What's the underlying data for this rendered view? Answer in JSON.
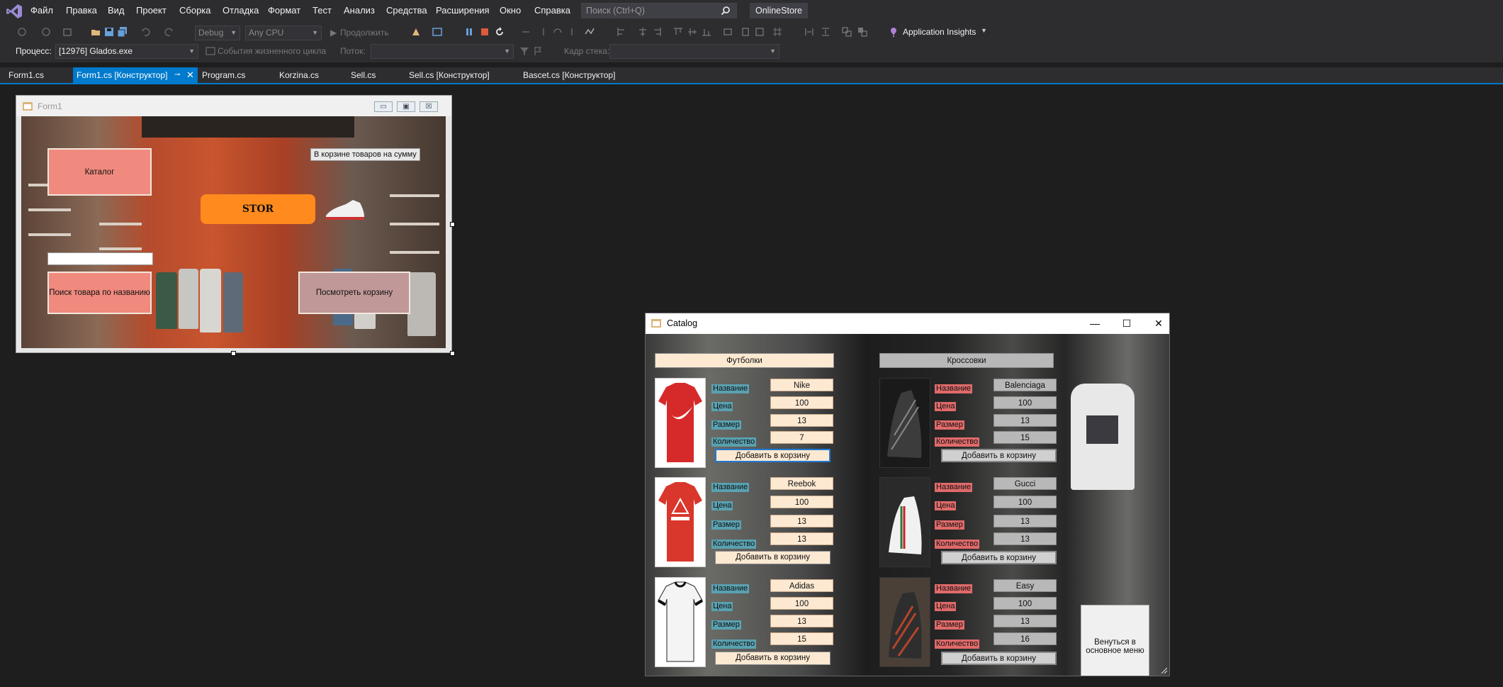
{
  "menubar": {
    "items": [
      "Файл",
      "Правка",
      "Вид",
      "Проект",
      "Сборка",
      "Отладка",
      "Формат",
      "Тест",
      "Анализ",
      "Средства",
      "Расширения",
      "Окно",
      "Справка"
    ],
    "search_placeholder": "Поиск (Ctrl+Q)",
    "solution_name": "OnlineStore"
  },
  "toolbar": {
    "config": "Debug",
    "platform": "Any CPU",
    "continue_label": "Продолжить",
    "app_insights": "Application Insights",
    "process_label": "Процесс:",
    "process_value": "[12976] Glados.exe",
    "lifecycle_label": "События жизненного цикла",
    "thread_label": "Поток:",
    "stack_label": "Кадр стека:"
  },
  "tabs": [
    "Form1.cs",
    "Form1.cs [Конструктор]",
    "Program.cs",
    "Korzina.cs",
    "Sell.cs",
    "Sell.cs [Конструктор]",
    "Bascet.cs [Конструктор]"
  ],
  "form1": {
    "title": "Form1",
    "catalog_button": "Каталог",
    "cart_sum_label": "В корзине товаров на сумму",
    "stor_logo": "STOR",
    "search_button": "Поиск товара по названию",
    "view_cart_button": "Посмотреть корзину"
  },
  "catalog": {
    "title": "Catalog",
    "tshirts_header": "Футболки",
    "sneakers_header": "Кроссовки",
    "labels": {
      "name": "Название",
      "price": "Цена",
      "size": "Размер",
      "qty": "Количество"
    },
    "add_label": "Добавить в корзину",
    "back_button": "Венуться в основное меню",
    "tshirts": [
      {
        "name": "Nike",
        "price": "100",
        "size": "13",
        "qty": "7"
      },
      {
        "name": "Reebok",
        "price": "100",
        "size": "13",
        "qty": "13"
      },
      {
        "name": "Adidas",
        "price": "100",
        "size": "13",
        "qty": "15"
      }
    ],
    "sneakers": [
      {
        "name": "Balenciaga",
        "price": "100",
        "size": "13",
        "qty": "15"
      },
      {
        "name": "Gucci",
        "price": "100",
        "size": "13",
        "qty": "13"
      },
      {
        "name": "Easy",
        "price": "100",
        "size": "13",
        "qty": "16"
      }
    ]
  },
  "colors": {
    "accent": "#007acc",
    "catalog_button": "#f08a7e",
    "view_cart_button": "#c09898",
    "stor_logo": "#ff8a1e",
    "tshirt_label": "#5aa1b0",
    "sneaker_label": "#e06a6a"
  }
}
